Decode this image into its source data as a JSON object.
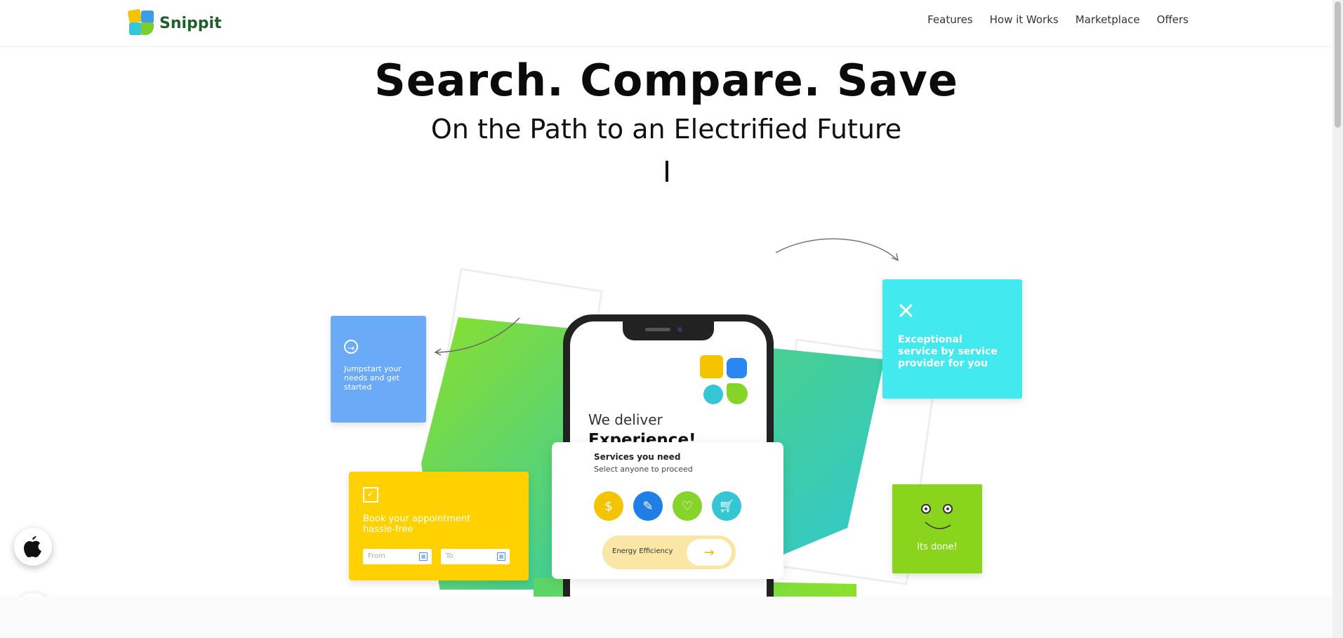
{
  "brand": {
    "name": "Snippit"
  },
  "nav": {
    "items": [
      "Features",
      "How it Works",
      "Marketplace",
      "Offers"
    ]
  },
  "hero": {
    "title": "Search. Compare. Save",
    "subtitle": "On the Path to an Electrified Future",
    "typing_cursor": "|"
  },
  "phone": {
    "line1": "We deliver",
    "line2": "Experience!"
  },
  "services_card": {
    "title": "Services you need",
    "subtitle": "Select anyone to proceed",
    "icons": [
      "savings-icon",
      "tools-icon",
      "health-icon",
      "cart-icon"
    ],
    "energy_label": "Energy Efficiency"
  },
  "cards": {
    "blue": {
      "text": "Jumpstart your needs and get started"
    },
    "cyan": {
      "text": "Exceptional service by service provider for you"
    },
    "yellow": {
      "text": "Book your appointment hassle-free",
      "from_placeholder": "From",
      "to_placeholder": "To"
    },
    "green": {
      "text": "Its done!"
    }
  },
  "colors": {
    "blue": "#6aaaf7",
    "cyan": "#42e9ee",
    "yellow": "#ffd100",
    "green": "#8bd41e",
    "brand_green": "#1f5f2a"
  }
}
